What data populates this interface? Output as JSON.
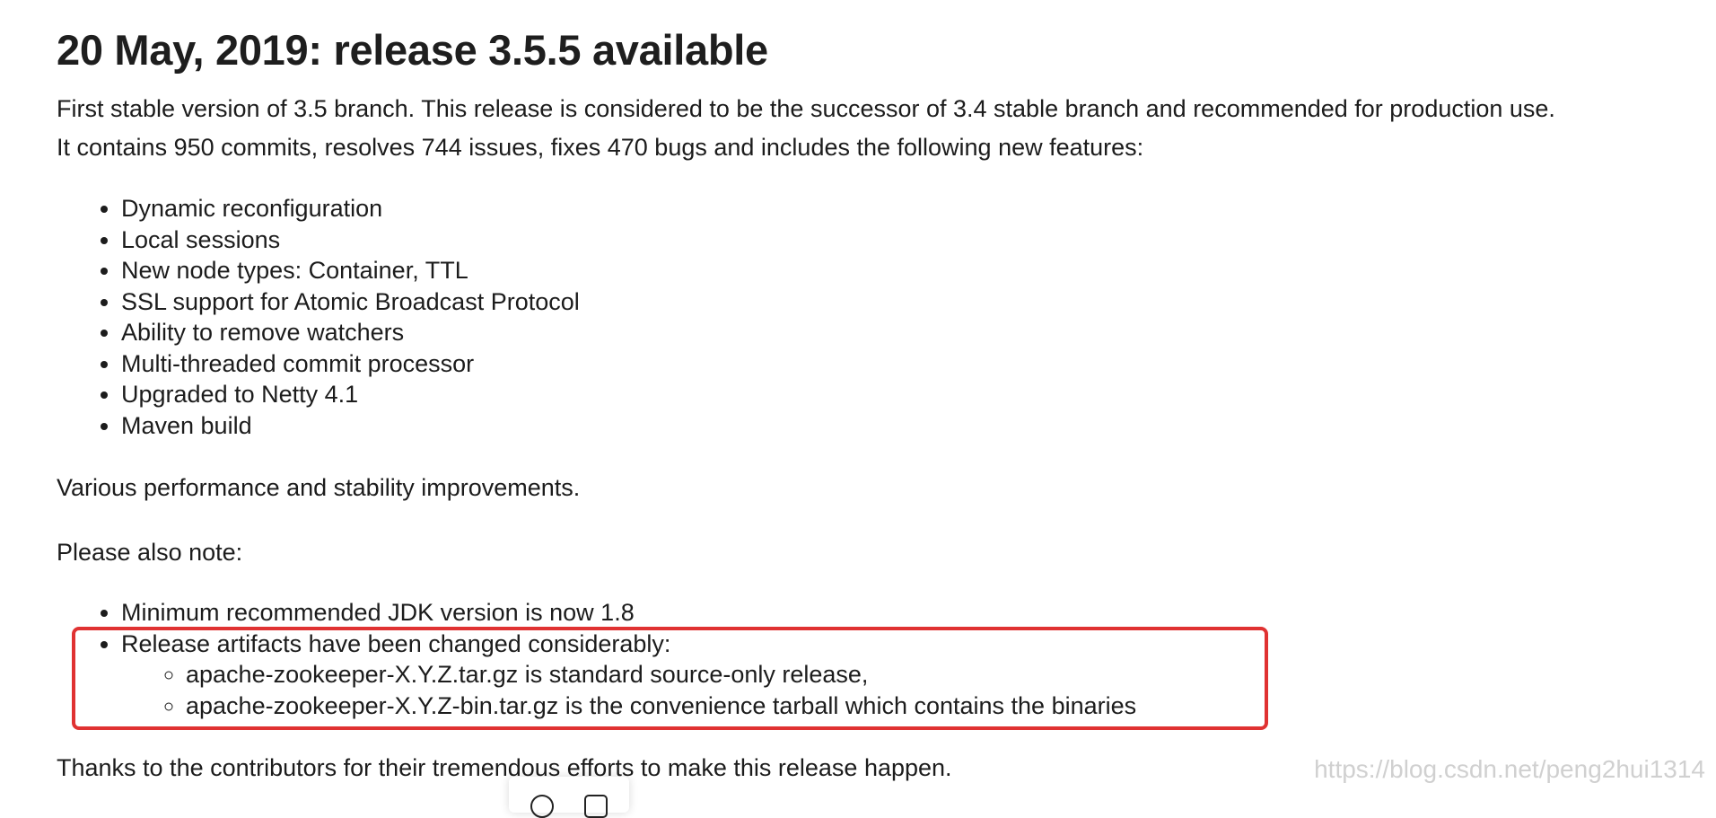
{
  "heading": "20 May, 2019: release 3.5.5 available",
  "intro": {
    "line1": "First stable version of 3.5 branch. This release is considered to be the successor of 3.4 stable branch and recommended for production use.",
    "line2": "It contains 950 commits, resolves 744 issues, fixes 470 bugs and includes the following new features:"
  },
  "features": [
    "Dynamic reconfiguration",
    "Local sessions",
    "New node types: Container, TTL",
    "SSL support for Atomic Broadcast Protocol",
    "Ability to remove watchers",
    "Multi-threaded commit processor",
    "Upgraded to Netty 4.1",
    "Maven build"
  ],
  "improvements": "Various performance and stability improvements.",
  "note_label": "Please also note:",
  "notes": {
    "jdk": "Minimum recommended JDK version is now 1.8",
    "artifacts": "Release artifacts have been changed considerably:",
    "sub": [
      "apache-zookeeper-X.Y.Z.tar.gz is standard source-only release,",
      "apache-zookeeper-X.Y.Z-bin.tar.gz is the convenience tarball which contains the binaries"
    ]
  },
  "thanks": "Thanks to the contributors for their tremendous efforts to make this release happen.",
  "watermark": "https://blog.csdn.net/peng2hui1314",
  "colors": {
    "highlight_border": "#e03232",
    "text": "#1c1c1c",
    "watermark": "#d0d0d0"
  },
  "toolbar": {
    "icons": [
      "circle-icon",
      "square-icon"
    ]
  }
}
